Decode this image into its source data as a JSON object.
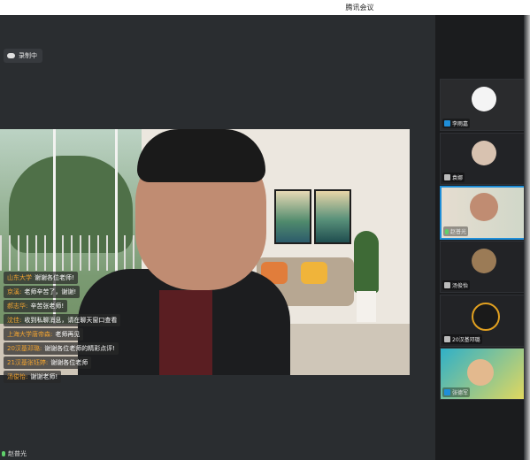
{
  "window": {
    "title": "腾讯会议"
  },
  "recording": {
    "label": "录制中",
    "icon": "cloud-icon"
  },
  "chat": [
    {
      "name": "山东大学",
      "text": "谢谢各位老师!"
    },
    {
      "name": "京溪:",
      "text": "老师辛苦了，谢谢!"
    },
    {
      "name": "郝志华:",
      "text": "辛苦张老师!"
    },
    {
      "name": "沈佳:",
      "text": "收到私聊消息，请在聊天窗口查看"
    },
    {
      "name": "上海大学唐帝森:",
      "text": "老师再见"
    },
    {
      "name": "20汉基邓璐:",
      "text": "谢谢各位老师的精彩点评!"
    },
    {
      "name": "21汉基张钰婷:",
      "text": "谢谢各位老师"
    },
    {
      "name": "汤俊怡:",
      "text": "谢谢老师!"
    }
  ],
  "speaker": {
    "name": "赵普光"
  },
  "participants": [
    {
      "name": "李雨嘉",
      "avatar_color": "#f4f4f4"
    },
    {
      "name": "袁娜",
      "avatar_color": "#d8c2b0"
    },
    {
      "name": "赵普光",
      "avatar_color": "#c08c72",
      "active": true
    },
    {
      "name": "汤俊怡",
      "avatar_color": "#9b7b56"
    },
    {
      "name": "20汉基邓璐",
      "avatar_color": "#e1a020"
    },
    {
      "name": "张德军",
      "avatar_color": "#2fb0c8"
    }
  ]
}
